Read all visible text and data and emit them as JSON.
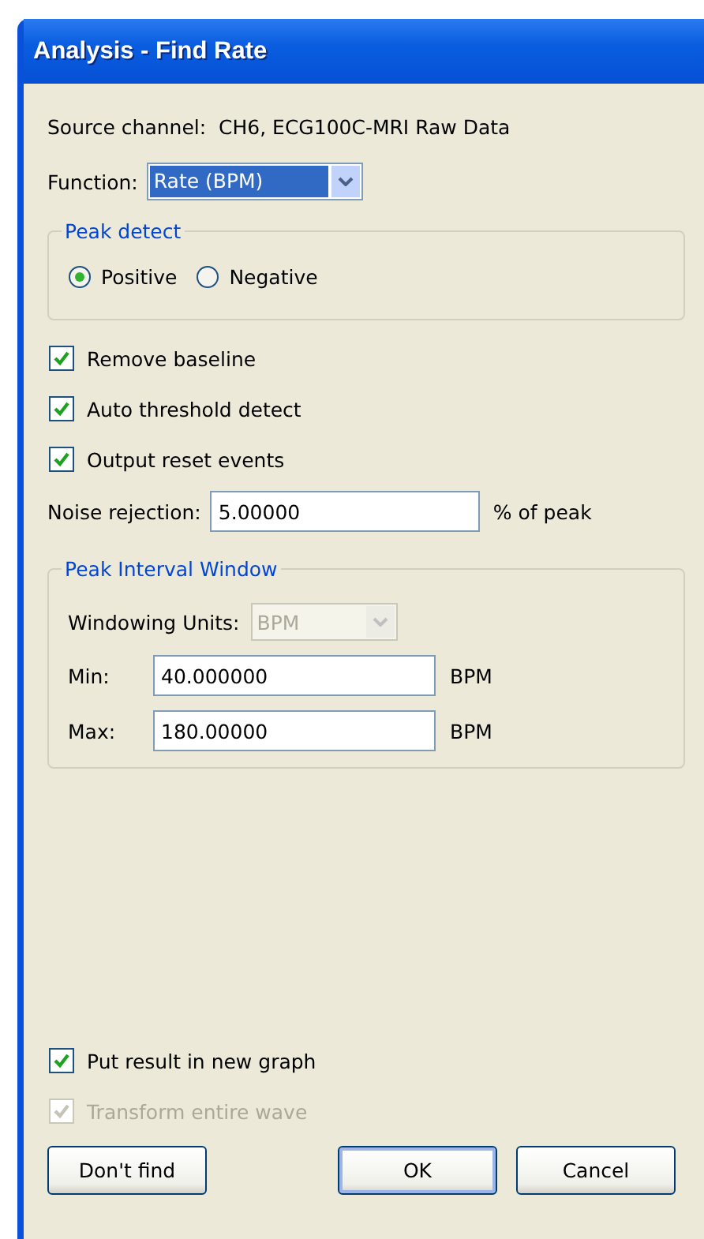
{
  "window": {
    "title": "Analysis - Find Rate"
  },
  "source_channel": "Source channel:  CH6, ECG100C-MRI Raw Data",
  "function": {
    "label": "Function:",
    "value": "Rate (BPM)",
    "focused": true
  },
  "peak_detect": {
    "title": "Peak detect",
    "options": [
      {
        "label": "Positive",
        "selected": true
      },
      {
        "label": "Negative",
        "selected": false
      }
    ]
  },
  "options": [
    {
      "label": "Remove baseline",
      "checked": true,
      "disabled": false
    },
    {
      "label": "Auto threshold detect",
      "checked": true,
      "disabled": false
    },
    {
      "label": "Output reset events",
      "checked": true,
      "disabled": false
    }
  ],
  "noise_rejection": {
    "label": "Noise rejection:",
    "value": "5.00000",
    "unit": "% of peak"
  },
  "peak_interval_window": {
    "title": "Peak Interval Window",
    "units": {
      "label": "Windowing Units:",
      "value": "BPM",
      "disabled": true
    },
    "fields": [
      {
        "label": "Min:",
        "value": "40.000000",
        "unit": "BPM"
      },
      {
        "label": "Max:",
        "value": "180.00000",
        "unit": "BPM"
      }
    ]
  },
  "output_options": [
    {
      "label": "Put result in new graph",
      "checked": true,
      "disabled": false
    },
    {
      "label": "Transform entire wave",
      "checked": true,
      "disabled": true
    }
  ],
  "buttons": [
    {
      "label": "Don't find",
      "default": false
    },
    {
      "label": "OK",
      "default": true
    },
    {
      "label": "Cancel",
      "default": false
    }
  ]
}
